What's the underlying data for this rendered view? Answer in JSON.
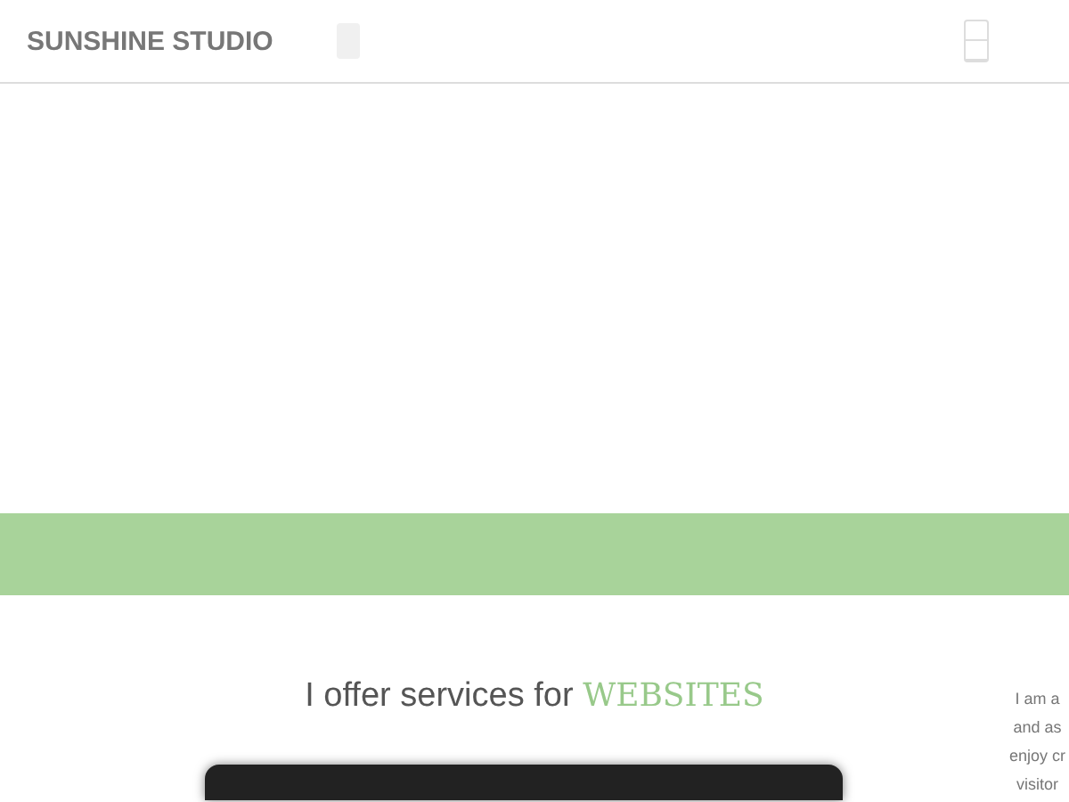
{
  "header": {
    "brand": "SUNSHINE STUDIO"
  },
  "services": {
    "lead": "I offer services for",
    "highlight": "WEBSITES"
  },
  "intro_lines": [
    "I am a",
    "and as",
    "enjoy cr",
    "visitor"
  ]
}
